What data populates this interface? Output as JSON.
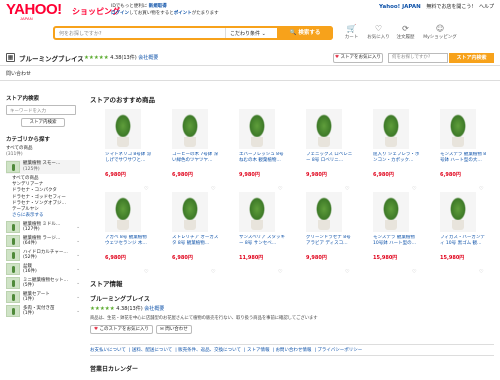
{
  "header": {
    "logo": "YAHOO!",
    "logo_sub": "JAPAN",
    "shop": "ショッピング",
    "promo_line1_pre": "IDでもっと便利に",
    "promo_line1_link": "新規取得",
    "promo_line2_pre": "ログイン",
    "promo_line2_mid": "してお買い物をすると",
    "promo_line2_link": "ポイント",
    "promo_line2_post": "がたまります",
    "toplinks": [
      "Yahoo! JAPAN",
      "無料でお店を開こう!",
      "ヘルプ"
    ]
  },
  "search": {
    "placeholder": "何をお探しですか?",
    "condition": "こだわり条件 ⌄",
    "button": "🔍 検索する"
  },
  "header_icons": [
    {
      "icon": "cart-icon",
      "glyph": "🛒",
      "label": "カート"
    },
    {
      "icon": "heart-icon",
      "glyph": "♡",
      "label": "お気に入り"
    },
    {
      "icon": "history-icon",
      "glyph": "⟳",
      "label": "注文履歴"
    },
    {
      "icon": "user-icon",
      "glyph": "☺",
      "label": "Myショッピング"
    }
  ],
  "store": {
    "name": "ブルーミングブレイス",
    "stars": "★★★★★",
    "rating": "4.38",
    "reviews": "(13件)",
    "overview": "会社概要",
    "fav_button": "ストアをお気に入り",
    "search_placeholder": "何をお探しですか?",
    "search_button": "ストア内検索",
    "contact": "問い合わせ"
  },
  "sidebar": {
    "search_title": "ストア内検索",
    "keyword_placeholder": "キーワードを入力",
    "search_button": "ストア内検索",
    "cat_title": "カテゴリから探す",
    "all_products": "すべての商品",
    "all_count": "(311件)",
    "selected": {
      "label": "観葉植物 スモー…",
      "count": "(125件)"
    },
    "subcats": [
      "すべての商品",
      "サンデリアーナ",
      "ドラセナ・コンパクタ",
      "ドラセナ・ゴッドセフィー",
      "ドラセナ・ソングオブジ…",
      "テーブルヤシ"
    ],
    "more": "さらに表示する",
    "categories": [
      {
        "label": "観葉植物 ミドル…",
        "count": "(127件)"
      },
      {
        "label": "観葉植物 ラージ…",
        "count": "(64件)"
      },
      {
        "label": "ハイドロカルチャー…",
        "count": "(52件)"
      },
      {
        "label": "盆栽",
        "count": "(16件)"
      },
      {
        "label": "ミニ観葉植物セット…",
        "count": "(5件)"
      },
      {
        "label": "観葉セアート",
        "count": "(1件)"
      },
      {
        "label": "多肉・実付き苗",
        "count": "(1件)"
      }
    ]
  },
  "main": {
    "title": "ストアのおすすめ商品",
    "products": [
      {
        "name": "シマトネリコ 8号鉢 涼しげでサワサワと…",
        "price": "6,980円"
      },
      {
        "name": "コーヒーの木 7号鉢 深い緑色のツヤツヤ…",
        "price": "6,980円"
      },
      {
        "name": "エバーフレッシュ 8号 ねむの木 観葉植物…",
        "price": "9,980円"
      },
      {
        "name": "フェニックス ロベレニー 8号 ロベリニ…",
        "price": "9,980円"
      },
      {
        "name": "屈入り シェフレラ・ホンコン・カポック…",
        "price": "6,980円"
      },
      {
        "name": "モンステラ 観葉植物 8号鉢 ハート型の大…",
        "price": "6,980円"
      },
      {
        "name": "アガベ 8号 観葉植物 ウェツセランジ 木…",
        "price": "6,980円"
      },
      {
        "name": "ストレリチア オーガスタ 8号 観葉植物…",
        "price": "6,980円"
      },
      {
        "name": "サンスベリア スタッキー 8号 サンセベ…",
        "price": "11,980円"
      },
      {
        "name": "グリーンドラセナ 8号 アラビア ディスコ…",
        "price": "9,980円"
      },
      {
        "name": "モンステラ 観葉植物 10号鉢 ハート型の…",
        "price": "15,980円"
      },
      {
        "name": "フィカス・バーガンディ 10号 黒ゴム 観…",
        "price": "15,980円"
      }
    ]
  },
  "store_info": {
    "title": "ストア情報",
    "name": "ブルーミングブレイス",
    "stars": "★★★★★",
    "rating": "4.38",
    "reviews": "(13件)",
    "overview": "会社概要",
    "desc": "商品は、生花・鉢花を中心に店舗型のお花屋さんにて植物の販売を行ない、取り扱う商品を事前に確認してございます",
    "fav_button": "このストアをお気に入り",
    "contact_button": "問い合わせ",
    "links": [
      "お支払いについて",
      "送料、配送について",
      "販売条件、返品、交換について",
      "ストア情報",
      "お問い合わせ情報",
      "プライバシーポリシー"
    ]
  },
  "calendar_title": "営業日カレンダー"
}
